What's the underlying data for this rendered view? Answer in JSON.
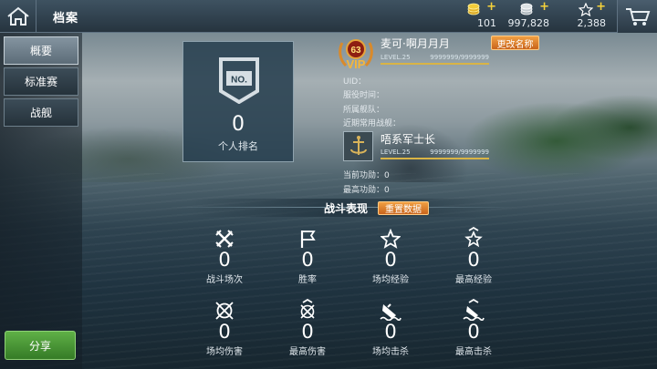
{
  "header": {
    "title": "档案",
    "resources": [
      {
        "icon": "gold-coins-icon",
        "value": "101"
      },
      {
        "icon": "silver-coins-icon",
        "value": "997,828"
      },
      {
        "icon": "star-icon",
        "value": "2,388"
      }
    ]
  },
  "sidebar": {
    "tabs": [
      {
        "label": "概要",
        "active": true
      },
      {
        "label": "标准赛",
        "active": false
      },
      {
        "label": "战舰",
        "active": false
      }
    ],
    "share_label": "分享"
  },
  "rank": {
    "badge_text": "NO.",
    "value": "0",
    "label": "个人排名"
  },
  "player": {
    "vip_level": "63",
    "vip_text": "VIP",
    "name": "麦可·啊月月月",
    "rename_label": "更改名称",
    "level": "LEVEL.25",
    "xp": "9999999/9999999",
    "uid_label": "UID：",
    "service_time_label": "服役时间：",
    "fleet_label": "所属舰队：",
    "common_ships_label": "近期常用战舰：",
    "ship_rank_title": "唔系军士长",
    "ship_level": "LEVEL.25",
    "ship_xp": "9999999/9999999",
    "current_merit_label": "当前功勋：",
    "current_merit_value": "0",
    "max_merit_label": "最高功勋：",
    "max_merit_value": "0"
  },
  "battle": {
    "title": "战斗表现",
    "reset_label": "重置数据",
    "stats": [
      {
        "icon": "crossed-swords-icon",
        "value": "0",
        "label": "战斗场次"
      },
      {
        "icon": "flag-icon",
        "value": "0",
        "label": "胜率"
      },
      {
        "icon": "star-outline-icon",
        "value": "0",
        "label": "场均经验"
      },
      {
        "icon": "star-chevron-icon",
        "value": "0",
        "label": "最高经验"
      },
      {
        "icon": "crosshair-icon",
        "value": "0",
        "label": "场均伤害"
      },
      {
        "icon": "crosshair-chevron-icon",
        "value": "0",
        "label": "最高伤害"
      },
      {
        "icon": "sinking-ship-icon",
        "value": "0",
        "label": "场均击杀"
      },
      {
        "icon": "sinking-ship-chevron-icon",
        "value": "0",
        "label": "最高击杀"
      }
    ]
  },
  "colors": {
    "accent_orange": "#e08a30",
    "share_green": "#4a9a38",
    "gold": "#f6d23a"
  }
}
